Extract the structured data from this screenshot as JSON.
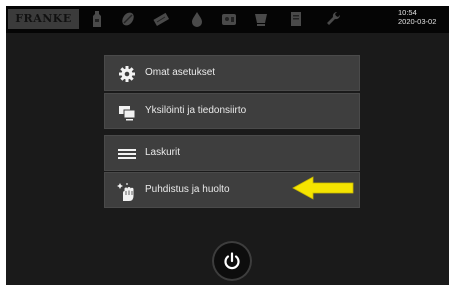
{
  "header": {
    "logo_text": "FRANKE",
    "time": "10:54",
    "date": "2020-03-02",
    "icons": [
      "bottle-icon",
      "bean-icon",
      "chocolate-icon",
      "drop-icon",
      "dispenser-icon",
      "cup-icon",
      "document-icon",
      "wrench-icon"
    ]
  },
  "menu": {
    "items": [
      {
        "label": "Omat asetukset",
        "icon": "gear-icon"
      },
      {
        "label": "Yksilöinti ja tiedonsiirto",
        "icon": "screens-icon"
      },
      {
        "label": "Laskurit",
        "icon": "list-icon"
      },
      {
        "label": "Puhdistus ja huolto",
        "icon": "cleaning-hand-icon"
      }
    ]
  },
  "annotation": {
    "color": "#f5e400",
    "icon": "arrow-left-icon"
  },
  "footer": {
    "icon": "power-icon"
  }
}
